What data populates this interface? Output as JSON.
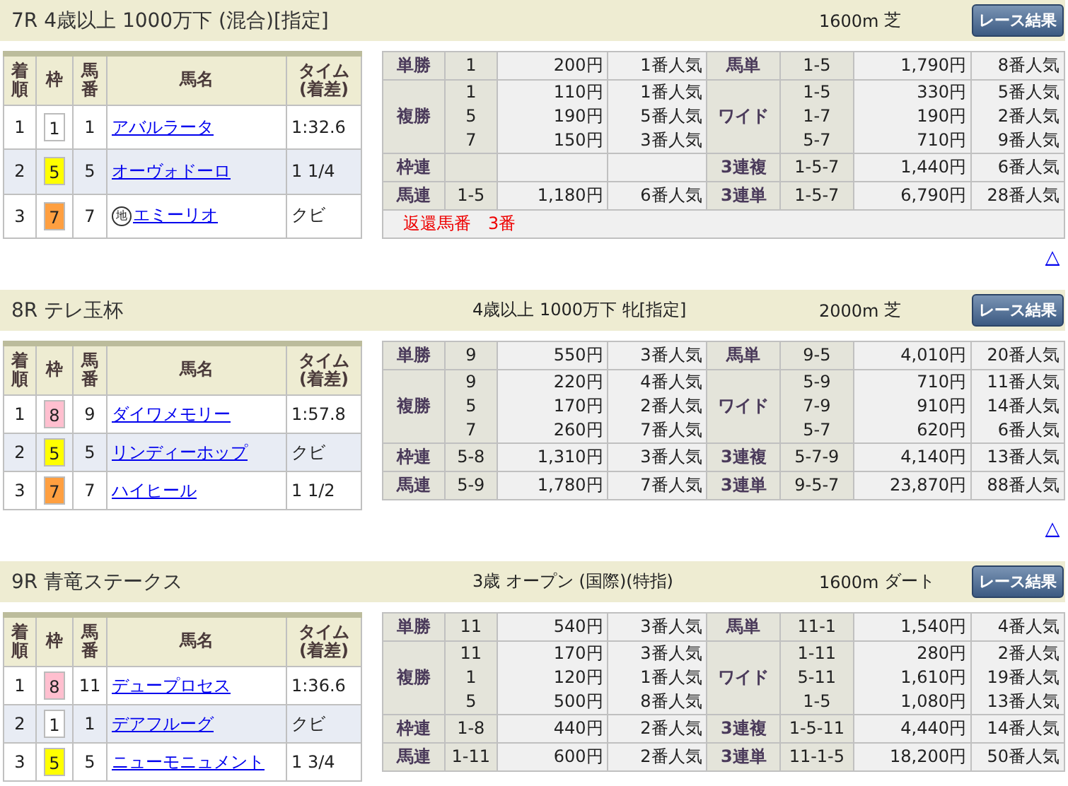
{
  "races": [
    {
      "title": "7R 4歳以上 1000万下 (混合)[指定]",
      "distance": "1600m",
      "surface": "芝",
      "button": "レース結果",
      "columns": [
        "着順",
        "枠",
        "馬番",
        "馬名",
        "タイム(着差)"
      ],
      "results": [
        {
          "rank": "1",
          "frame": "1",
          "color": "#ffffff",
          "number": "1",
          "horse": "アバルラータ",
          "time": "1:32.6"
        },
        {
          "rank": "2",
          "frame": "5",
          "color": "#ffff00",
          "number": "5",
          "horse": "オーヴォドーロ",
          "time": "1 1/4"
        },
        {
          "rank": "3",
          "frame": "7",
          "color": "#ff9f40",
          "number": "7",
          "horse": "エミーリオ",
          "badge": "地",
          "time": "クビ"
        }
      ],
      "payouts_left": [
        {
          "type": "単勝",
          "entries": [
            {
              "combo": "1",
              "amount": "200円",
              "popularity": "1番人気"
            }
          ]
        },
        {
          "type": "複勝",
          "entries": [
            {
              "combo": "1",
              "amount": "110円",
              "popularity": "1番人気"
            },
            {
              "combo": "5",
              "amount": "190円",
              "popularity": "5番人気"
            },
            {
              "combo": "7",
              "amount": "150円",
              "popularity": "3番人気"
            }
          ]
        },
        {
          "type": "枠連"
        },
        {
          "type": "馬連",
          "entries": [
            {
              "combo": "1-5",
              "amount": "1,180円",
              "popularity": "6番人気"
            }
          ]
        }
      ],
      "payouts_right": [
        {
          "type": "馬単",
          "entries": [
            {
              "combo": "1-5",
              "amount": "1,790円",
              "popularity": "8番人気"
            }
          ]
        },
        {
          "type": "ワイド",
          "entries": [
            {
              "combo": "1-5",
              "amount": "330円",
              "popularity": "5番人気"
            },
            {
              "combo": "1-7",
              "amount": "190円",
              "popularity": "2番人気"
            },
            {
              "combo": "5-7",
              "amount": "710円",
              "popularity": "9番人気"
            }
          ]
        },
        {
          "type": "3連複",
          "entries": [
            {
              "combo": "1-5-7",
              "amount": "1,440円",
              "popularity": "6番人気"
            }
          ]
        },
        {
          "type": "3連単",
          "entries": [
            {
              "combo": "1-5-7",
              "amount": "6,790円",
              "popularity": "28番人気"
            }
          ]
        }
      ],
      "note": "返還馬番　3番",
      "top_link": "△"
    },
    {
      "title": "8R テレ玉杯",
      "conditions": "4歳以上 1000万下 牝[指定]",
      "distance": "2000m",
      "surface": "芝",
      "button": "レース結果",
      "columns": [
        "着順",
        "枠",
        "馬番",
        "馬名",
        "タイム(着差)"
      ],
      "results": [
        {
          "rank": "1",
          "frame": "8",
          "color": "#ffbfcf",
          "number": "9",
          "horse": "ダイワメモリー",
          "time": "1:57.8"
        },
        {
          "rank": "2",
          "frame": "5",
          "color": "#ffff00",
          "number": "5",
          "horse": "リンディーホップ",
          "time": "クビ"
        },
        {
          "rank": "3",
          "frame": "7",
          "color": "#ff9f40",
          "number": "7",
          "horse": "ハイヒール",
          "time": "1 1/2"
        }
      ],
      "payouts_left": [
        {
          "type": "単勝",
          "entries": [
            {
              "combo": "9",
              "amount": "550円",
              "popularity": "3番人気"
            }
          ]
        },
        {
          "type": "複勝",
          "entries": [
            {
              "combo": "9",
              "amount": "220円",
              "popularity": "4番人気"
            },
            {
              "combo": "5",
              "amount": "170円",
              "popularity": "2番人気"
            },
            {
              "combo": "7",
              "amount": "260円",
              "popularity": "7番人気"
            }
          ]
        },
        {
          "type": "枠連",
          "entries": [
            {
              "combo": "5-8",
              "amount": "1,310円",
              "popularity": "3番人気"
            }
          ]
        },
        {
          "type": "馬連",
          "entries": [
            {
              "combo": "5-9",
              "amount": "1,780円",
              "popularity": "7番人気"
            }
          ]
        }
      ],
      "payouts_right": [
        {
          "type": "馬単",
          "entries": [
            {
              "combo": "9-5",
              "amount": "4,010円",
              "popularity": "20番人気"
            }
          ]
        },
        {
          "type": "ワイド",
          "entries": [
            {
              "combo": "5-9",
              "amount": "710円",
              "popularity": "11番人気"
            },
            {
              "combo": "7-9",
              "amount": "910円",
              "popularity": "14番人気"
            },
            {
              "combo": "5-7",
              "amount": "620円",
              "popularity": "6番人気"
            }
          ]
        },
        {
          "type": "3連複",
          "entries": [
            {
              "combo": "5-7-9",
              "amount": "4,140円",
              "popularity": "13番人気"
            }
          ]
        },
        {
          "type": "3連単",
          "entries": [
            {
              "combo": "9-5-7",
              "amount": "23,870円",
              "popularity": "88番人気"
            }
          ]
        }
      ],
      "top_link": "△"
    },
    {
      "title": "9R 青竜ステークス",
      "conditions": "3歳 オープン (国際)(特指)",
      "distance": "1600m",
      "surface": "ダート",
      "button": "レース結果",
      "columns": [
        "着順",
        "枠",
        "馬番",
        "馬名",
        "タイム(着差)"
      ],
      "results": [
        {
          "rank": "1",
          "frame": "8",
          "color": "#ffbfcf",
          "number": "11",
          "horse": "デュープロセス",
          "time": "1:36.6"
        },
        {
          "rank": "2",
          "frame": "1",
          "color": "#ffffff",
          "number": "1",
          "horse": "デアフルーグ",
          "time": "クビ"
        },
        {
          "rank": "3",
          "frame": "5",
          "color": "#ffff00",
          "number": "5",
          "horse": "ニューモニュメント",
          "time": "1 3/4"
        }
      ],
      "payouts_left": [
        {
          "type": "単勝",
          "entries": [
            {
              "combo": "11",
              "amount": "540円",
              "popularity": "3番人気"
            }
          ]
        },
        {
          "type": "複勝",
          "entries": [
            {
              "combo": "11",
              "amount": "170円",
              "popularity": "3番人気"
            },
            {
              "combo": "1",
              "amount": "120円",
              "popularity": "1番人気"
            },
            {
              "combo": "5",
              "amount": "500円",
              "popularity": "8番人気"
            }
          ]
        },
        {
          "type": "枠連",
          "entries": [
            {
              "combo": "1-8",
              "amount": "440円",
              "popularity": "2番人気"
            }
          ]
        },
        {
          "type": "馬連",
          "entries": [
            {
              "combo": "1-11",
              "amount": "600円",
              "popularity": "2番人気"
            }
          ]
        }
      ],
      "payouts_right": [
        {
          "type": "馬単",
          "entries": [
            {
              "combo": "11-1",
              "amount": "1,540円",
              "popularity": "4番人気"
            }
          ]
        },
        {
          "type": "ワイド",
          "entries": [
            {
              "combo": "1-11",
              "amount": "280円",
              "popularity": "2番人気"
            },
            {
              "combo": "5-11",
              "amount": "1,610円",
              "popularity": "19番人気"
            },
            {
              "combo": "1-5",
              "amount": "1,080円",
              "popularity": "13番人気"
            }
          ]
        },
        {
          "type": "3連複",
          "entries": [
            {
              "combo": "1-5-11",
              "amount": "4,440円",
              "popularity": "14番人気"
            }
          ]
        },
        {
          "type": "3連単",
          "entries": [
            {
              "combo": "11-1-5",
              "amount": "18,200円",
              "popularity": "50番人気"
            }
          ]
        }
      ]
    }
  ]
}
